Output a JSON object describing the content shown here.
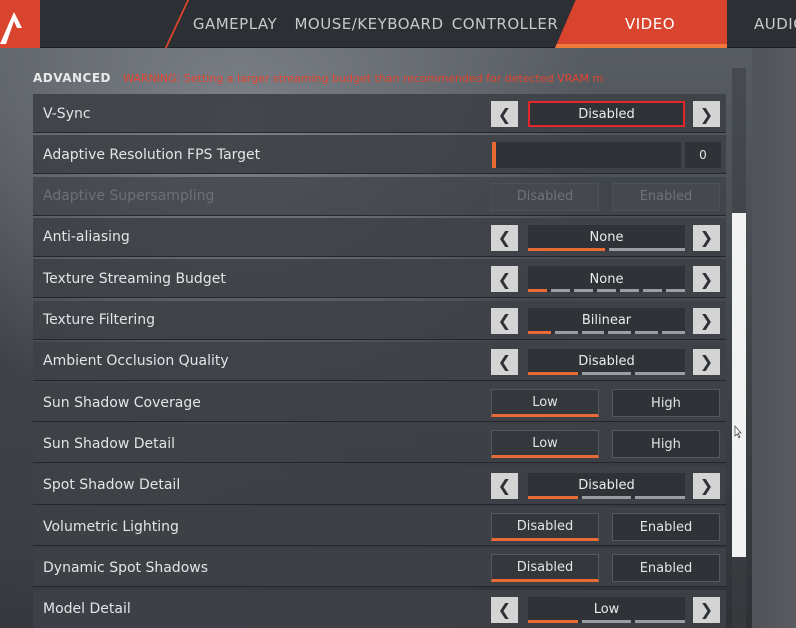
{
  "nav": {
    "tabs": [
      {
        "label": "GAMEPLAY",
        "active": false
      },
      {
        "label": "MOUSE/KEYBOARD",
        "active": false
      },
      {
        "label": "CONTROLLER",
        "active": false
      },
      {
        "label": "VIDEO",
        "active": true
      },
      {
        "label": "AUDIO",
        "active": false
      }
    ]
  },
  "section": {
    "title": "ADVANCED",
    "warning": "WARNING: Setting a larger streaming budget than recommended for detected VRAM m"
  },
  "settings": [
    {
      "label": "V-Sync",
      "type": "stepper",
      "value": "Disabled",
      "highlighted": true
    },
    {
      "label": "Adaptive Resolution FPS Target",
      "type": "slider",
      "value": "0",
      "fill_fraction": 0.02
    },
    {
      "label": "Adaptive Supersampling",
      "type": "toggle",
      "options": [
        "Disabled",
        "Enabled"
      ],
      "selected": null,
      "disabled": true
    },
    {
      "label": "Anti-aliasing",
      "type": "stepper",
      "value": "None",
      "ticks": 2,
      "tick_on": 0
    },
    {
      "label": "Texture Streaming Budget",
      "type": "stepper",
      "value": "None",
      "ticks": 7,
      "tick_on": 0
    },
    {
      "label": "Texture Filtering",
      "type": "stepper",
      "value": "Bilinear",
      "ticks": 6,
      "tick_on": 0
    },
    {
      "label": "Ambient Occlusion Quality",
      "type": "stepper",
      "value": "Disabled",
      "ticks": 3,
      "tick_on": 0
    },
    {
      "label": "Sun Shadow Coverage",
      "type": "toggle",
      "options": [
        "Low",
        "High"
      ],
      "selected": 0
    },
    {
      "label": "Sun Shadow Detail",
      "type": "toggle",
      "options": [
        "Low",
        "High"
      ],
      "selected": 0
    },
    {
      "label": "Spot Shadow Detail",
      "type": "stepper",
      "value": "Disabled",
      "ticks": 3,
      "tick_on": 0
    },
    {
      "label": "Volumetric Lighting",
      "type": "toggle",
      "options": [
        "Disabled",
        "Enabled"
      ],
      "selected": 0
    },
    {
      "label": "Dynamic Spot Shadows",
      "type": "toggle",
      "options": [
        "Disabled",
        "Enabled"
      ],
      "selected": 0
    },
    {
      "label": "Model Detail",
      "type": "stepper",
      "value": "Low",
      "ticks": 3,
      "tick_on": 0
    }
  ],
  "colors": {
    "accent": "#d9442e",
    "highlight_border": "#e3262b",
    "selected_underline": "#e86a35"
  },
  "icons": {
    "logo": "apex-logo-icon",
    "left": "chevron-left-icon",
    "right": "chevron-right-icon"
  }
}
